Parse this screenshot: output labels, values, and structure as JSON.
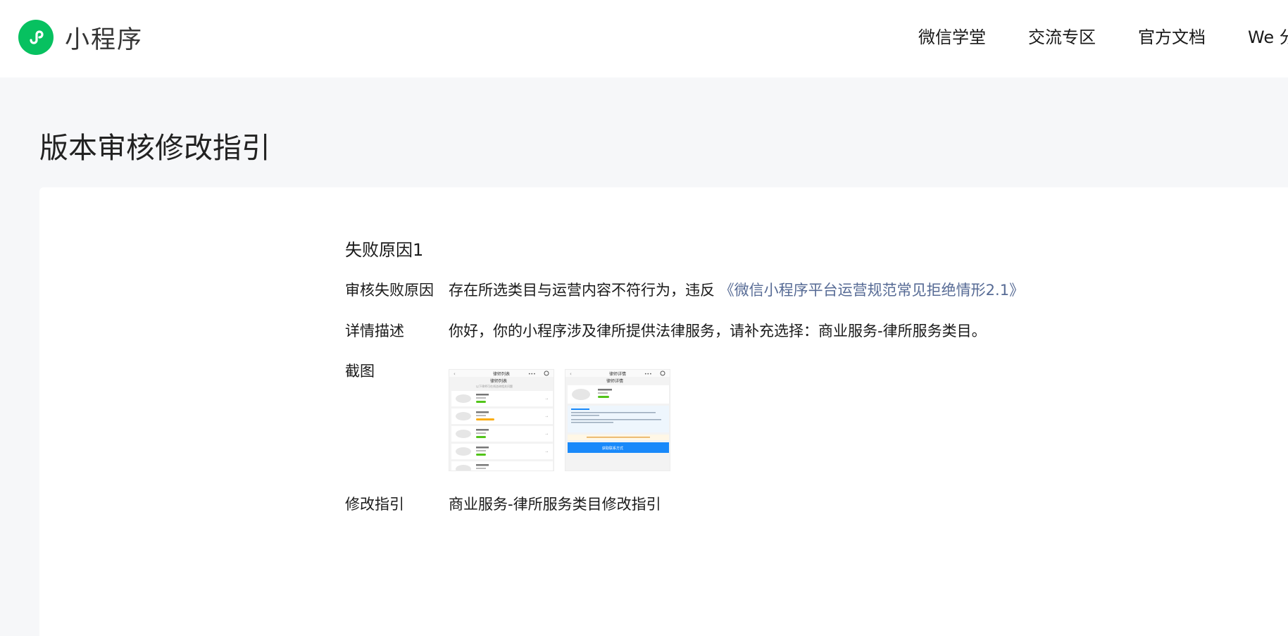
{
  "header": {
    "brand": "小程序",
    "nav": [
      "微信学堂",
      "交流专区",
      "官方文档",
      "We 分"
    ]
  },
  "page": {
    "title": "版本审核修改指引"
  },
  "failure": {
    "title": "失败原因1",
    "reason_label": "审核失败原因",
    "reason_text": "存在所选类目与运营内容不符行为，违反",
    "reason_link": "《微信小程序平台运营规范常见拒绝情形2.1》",
    "detail_label": "详情描述",
    "detail_text": "你好，你的小程序涉及律所提供法律服务，请补充选择：商业服务-律所服务类目。",
    "screenshot_label": "截图",
    "screenshots": [
      {
        "title": "律师列表",
        "subtitle": "以下律师可在线咨询相关问题"
      },
      {
        "title": "律师详情",
        "button": "获取联系方式"
      }
    ],
    "guide_label": "修改指引",
    "guide_link": "商业服务-律所服务类目修改指引"
  },
  "colors": {
    "brand_green": "#07c160",
    "link": "#576b95",
    "page_bg": "#f6f7f9",
    "card_bg": "#ffffff",
    "phone_button": "#1989fa",
    "tag_green": "#52c41a",
    "tag_orange": "#faad14"
  },
  "icons": {
    "logo": "mini-program-logo-icon",
    "back": "back-arrow-icon",
    "menu": "more-dots-icon",
    "capsule": "target-icon"
  }
}
